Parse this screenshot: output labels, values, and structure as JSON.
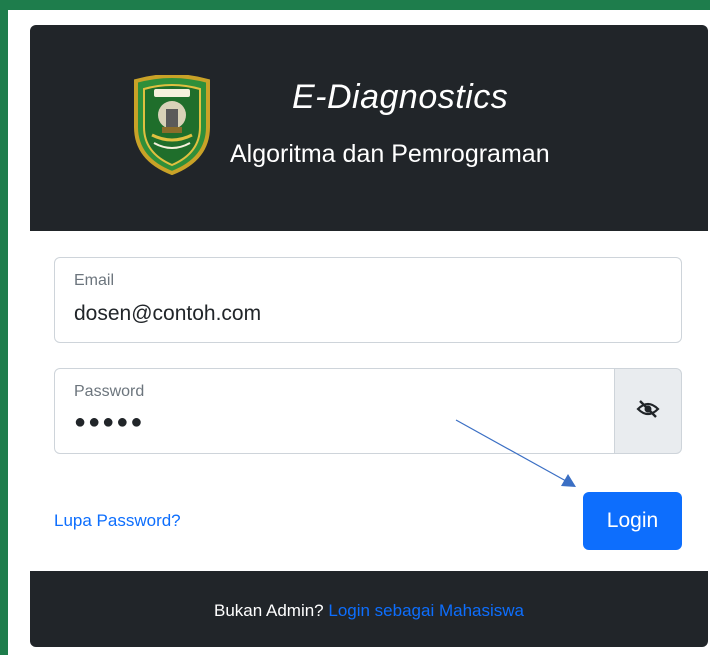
{
  "header": {
    "title": "E-Diagnostics",
    "subtitle": "Algoritma dan Pemrograman",
    "logo_icon": "regional-emblem-shield-icon"
  },
  "form": {
    "email": {
      "label": "Email",
      "value": "dosen@contoh.com"
    },
    "password": {
      "label": "Password",
      "value": "●●●●●",
      "toggle_icon": "eye-slash-icon"
    },
    "forgot_password": "Lupa Password?",
    "login_button": "Login"
  },
  "footer": {
    "prompt": "Bukan Admin?",
    "link": "Login sebagai Mahasiswa"
  },
  "colors": {
    "page_background": "#1e7d4c",
    "header_background": "#212529",
    "accent": "#0d6efd",
    "annotation_arrow": "#3b6fc4"
  }
}
